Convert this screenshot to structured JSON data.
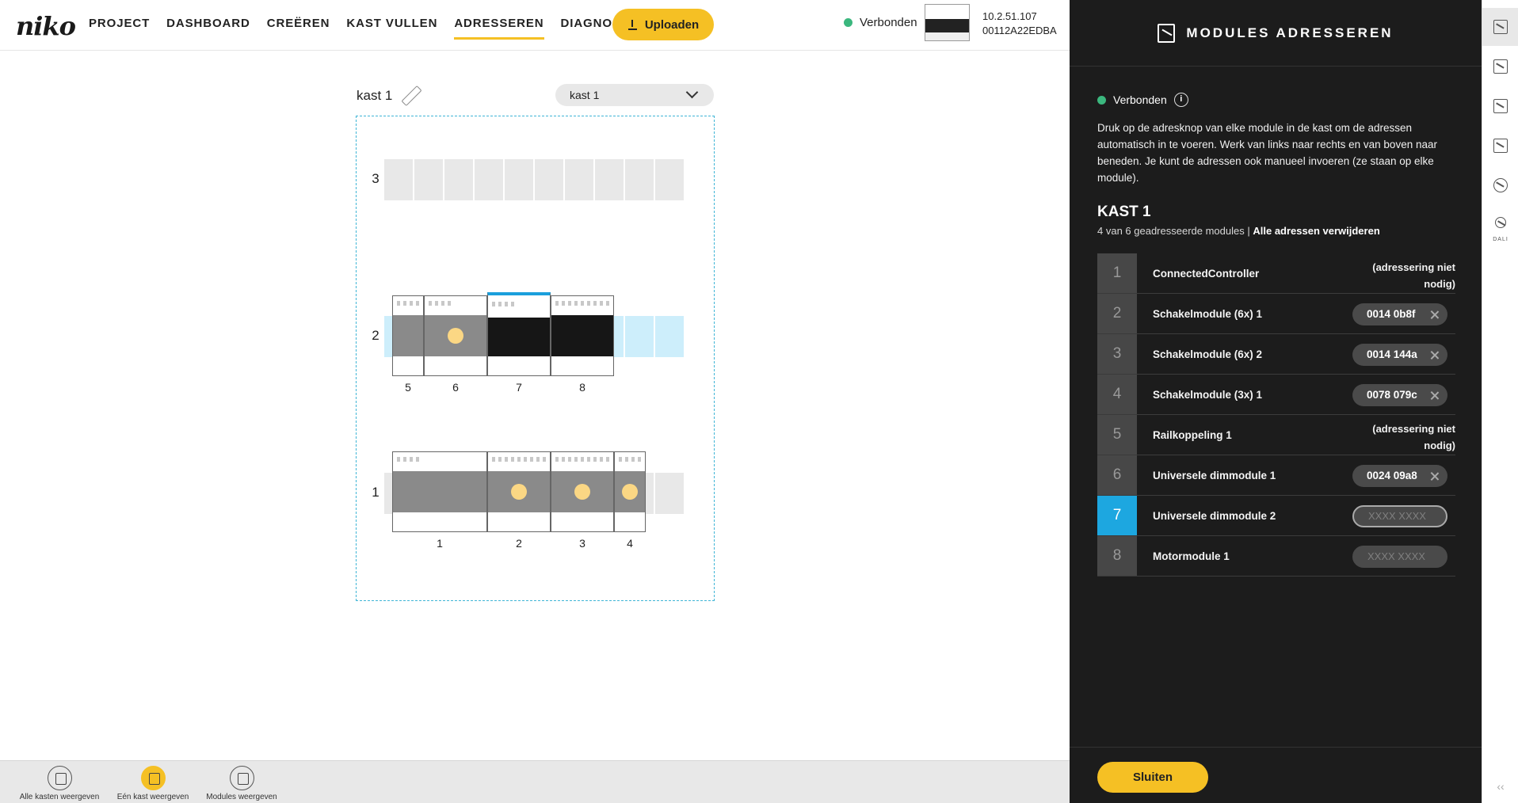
{
  "logo": "niko",
  "nav": [
    {
      "label": "PROJECT",
      "active": false
    },
    {
      "label": "DASHBOARD",
      "active": false
    },
    {
      "label": "CREËREN",
      "active": false
    },
    {
      "label": "KAST VULLEN",
      "active": false
    },
    {
      "label": "ADRESSEREN",
      "active": true
    },
    {
      "label": "DIAGNOSE",
      "active": false,
      "external": true
    }
  ],
  "upload_label": "Uploaden",
  "connection": {
    "label": "Verbonden",
    "color": "#3bb77e"
  },
  "controller": {
    "ip": "10.2.51.107",
    "mac": "00112A22EDBA"
  },
  "main": {
    "kast_title": "kast 1",
    "kast_select": "kast 1",
    "rails": [
      {
        "number": "3"
      },
      {
        "number": "2"
      },
      {
        "number": "1"
      }
    ],
    "module_numbers": {
      "rail2": [
        "5",
        "6",
        "7",
        "8"
      ],
      "rail1": [
        "1",
        "2",
        "3",
        "4"
      ]
    }
  },
  "bottombar": {
    "items": [
      {
        "label": "Alle kasten weergeven",
        "active": false
      },
      {
        "label": "Eén kast weergeven",
        "active": true
      },
      {
        "label": "Modules weergeven",
        "active": false
      }
    ]
  },
  "panel": {
    "title": "MODULES ADRESSEREN",
    "status": "Verbonden",
    "info": "i",
    "instructions": "Druk op de adresknop van elke module in de kast om de adressen automatisch in te voeren. Werk van links naar rechts en van boven naar beneden. Je kunt de adressen ook manueel invoeren (ze staan op elke module).",
    "kast_heading": "KAST 1",
    "count_text": "4 van 6 geadresseerde modules |",
    "remove_all": "Alle adressen verwijderen",
    "modules": [
      {
        "num": "1",
        "name": "ConnectedController",
        "note": "(adressering niet nodig)"
      },
      {
        "num": "2",
        "name": "Schakelmodule (6x) 1",
        "address": "0014 0b8f"
      },
      {
        "num": "3",
        "name": "Schakelmodule (6x) 2",
        "address": "0014 144a"
      },
      {
        "num": "4",
        "name": "Schakelmodule (3x) 1",
        "address": "0078 079c"
      },
      {
        "num": "5",
        "name": "Railkoppeling 1",
        "note": "(adressering niet nodig)"
      },
      {
        "num": "6",
        "name": "Universele dimmodule 1",
        "address": "0024 09a8"
      },
      {
        "num": "7",
        "name": "Universele dimmodule 2",
        "placeholder": "XXXX XXXX",
        "active": true
      },
      {
        "num": "8",
        "name": "Motormodule 1",
        "placeholder": "XXXX XXXX"
      }
    ],
    "close_label": "Sluiten"
  },
  "strip": {
    "dali_label": "DALI"
  },
  "colors": {
    "accent": "#f5c024",
    "active_blue": "#1da7e0",
    "panel_bg": "#1c1c1c"
  }
}
